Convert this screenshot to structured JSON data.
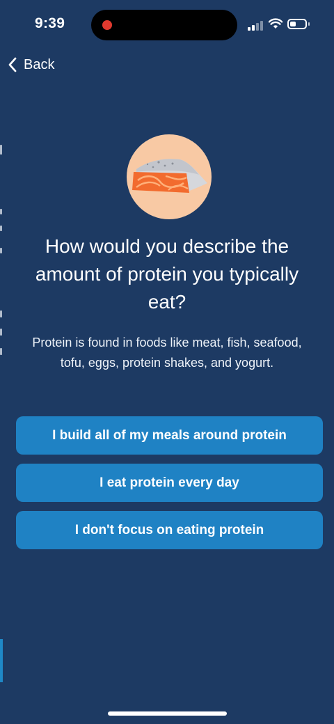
{
  "status": {
    "time": "9:39"
  },
  "nav": {
    "back_label": "Back"
  },
  "question": {
    "title": "How would you describe the amount of protein you typically eat?",
    "subtitle": "Protein is found in foods like meat, fish, seafood, tofu, eggs, protein shakes, and yogurt."
  },
  "options": [
    {
      "label": "I build all of my meals around protein"
    },
    {
      "label": "I eat protein every day"
    },
    {
      "label": "I don't focus on eating protein"
    }
  ],
  "colors": {
    "background": "#1d3a63",
    "option_button": "#1f82c4",
    "icon_circle": "#f8c9a4",
    "salmon": "#f26b2e",
    "record_dot": "#e03a2f"
  },
  "icons": {
    "hero": "salmon-fillet-icon",
    "back": "chevron-left-icon",
    "status": [
      "signal-icon",
      "wifi-icon",
      "battery-icon"
    ]
  }
}
